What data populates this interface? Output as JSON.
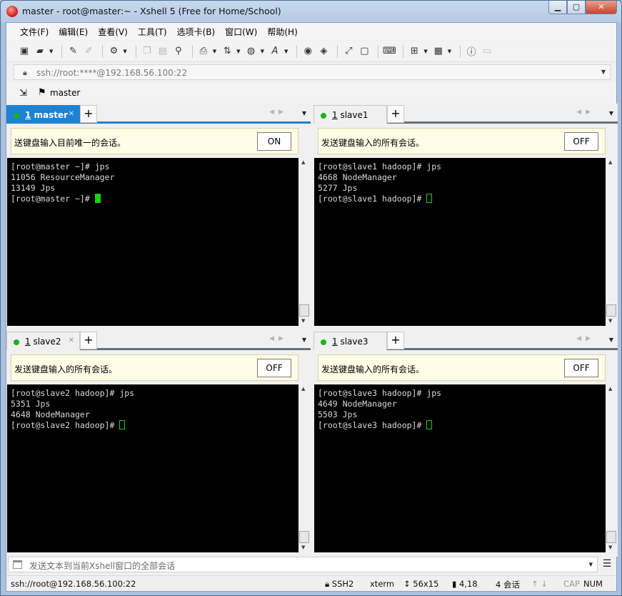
{
  "window": {
    "title": "master - root@master:~ - Xshell 5 (Free for Home/School)",
    "buttons": {
      "minimize": "▁",
      "maximize": "▢",
      "close": "✕"
    }
  },
  "menu": [
    "文件(F)",
    "编辑(E)",
    "查看(V)",
    "工具(T)",
    "选项卡(B)",
    "窗口(W)",
    "帮助(H)"
  ],
  "toolbar": {
    "icons": [
      "new-session-icon",
      "open-folder-icon",
      "reconnect-icon",
      "disconnect-icon",
      "properties-icon",
      "copy-icon",
      "paste-icon",
      "find-icon",
      "print-icon",
      "transfer-icon",
      "globe-icon",
      "font-icon",
      "xftp-icon",
      "xmanager-icon",
      "fullscreen-icon",
      "lock-icon",
      "keyboard-icon",
      "new-tab-icon",
      "layout-icon",
      "help-icon",
      "chat-icon"
    ]
  },
  "address": {
    "text": "ssh://root:****@192.168.56.100:22"
  },
  "session_bar": {
    "label": "master"
  },
  "panes": [
    {
      "tab_number": "1",
      "tab_label": "master",
      "tab_close": "✕",
      "notice": "送键盘输入目前唯一的会话。",
      "toggle": "ON",
      "lines": [
        "[root@master ~]# jps",
        "11056 ResourceManager",
        "13149 Jps",
        "[root@master ~]# "
      ]
    },
    {
      "tab_number": "1",
      "tab_label": "slave1",
      "notice": "发送键盘输入的所有会话。",
      "toggle": "OFF",
      "lines": [
        "[root@slave1 hadoop]# jps",
        "4668 NodeManager",
        "5277 Jps",
        "[root@slave1 hadoop]# "
      ]
    },
    {
      "tab_number": "1",
      "tab_label": "slave2",
      "tab_close": "✕",
      "notice": "发送键盘输入的所有会话。",
      "toggle": "OFF",
      "lines": [
        "[root@slave2 hadoop]# jps",
        "5351 Jps",
        "4648 NodeManager",
        "[root@slave2 hadoop]# "
      ]
    },
    {
      "tab_number": "1",
      "tab_label": "slave3",
      "notice": "发送键盘输入的所有会话。",
      "toggle": "OFF",
      "lines": [
        "[root@slave3 hadoop]# jps",
        "4649 NodeManager",
        "5503 Jps",
        "[root@slave3 hadoop]# "
      ]
    }
  ],
  "send_bar": {
    "placeholder": "发送文本到当前Xshell窗口的全部会话"
  },
  "status": {
    "connection": "ssh://root@192.168.56.100:22",
    "protocol": "SSH2",
    "terminal": "xterm",
    "size": "56x15",
    "cursor_pos": "4,18",
    "sessions": "4 会话",
    "cap": "CAP",
    "num": "NUM"
  },
  "colors": {
    "active_tab": "#1c82d4",
    "status_dot": "#1ab11a",
    "cursor": "#14d314"
  }
}
